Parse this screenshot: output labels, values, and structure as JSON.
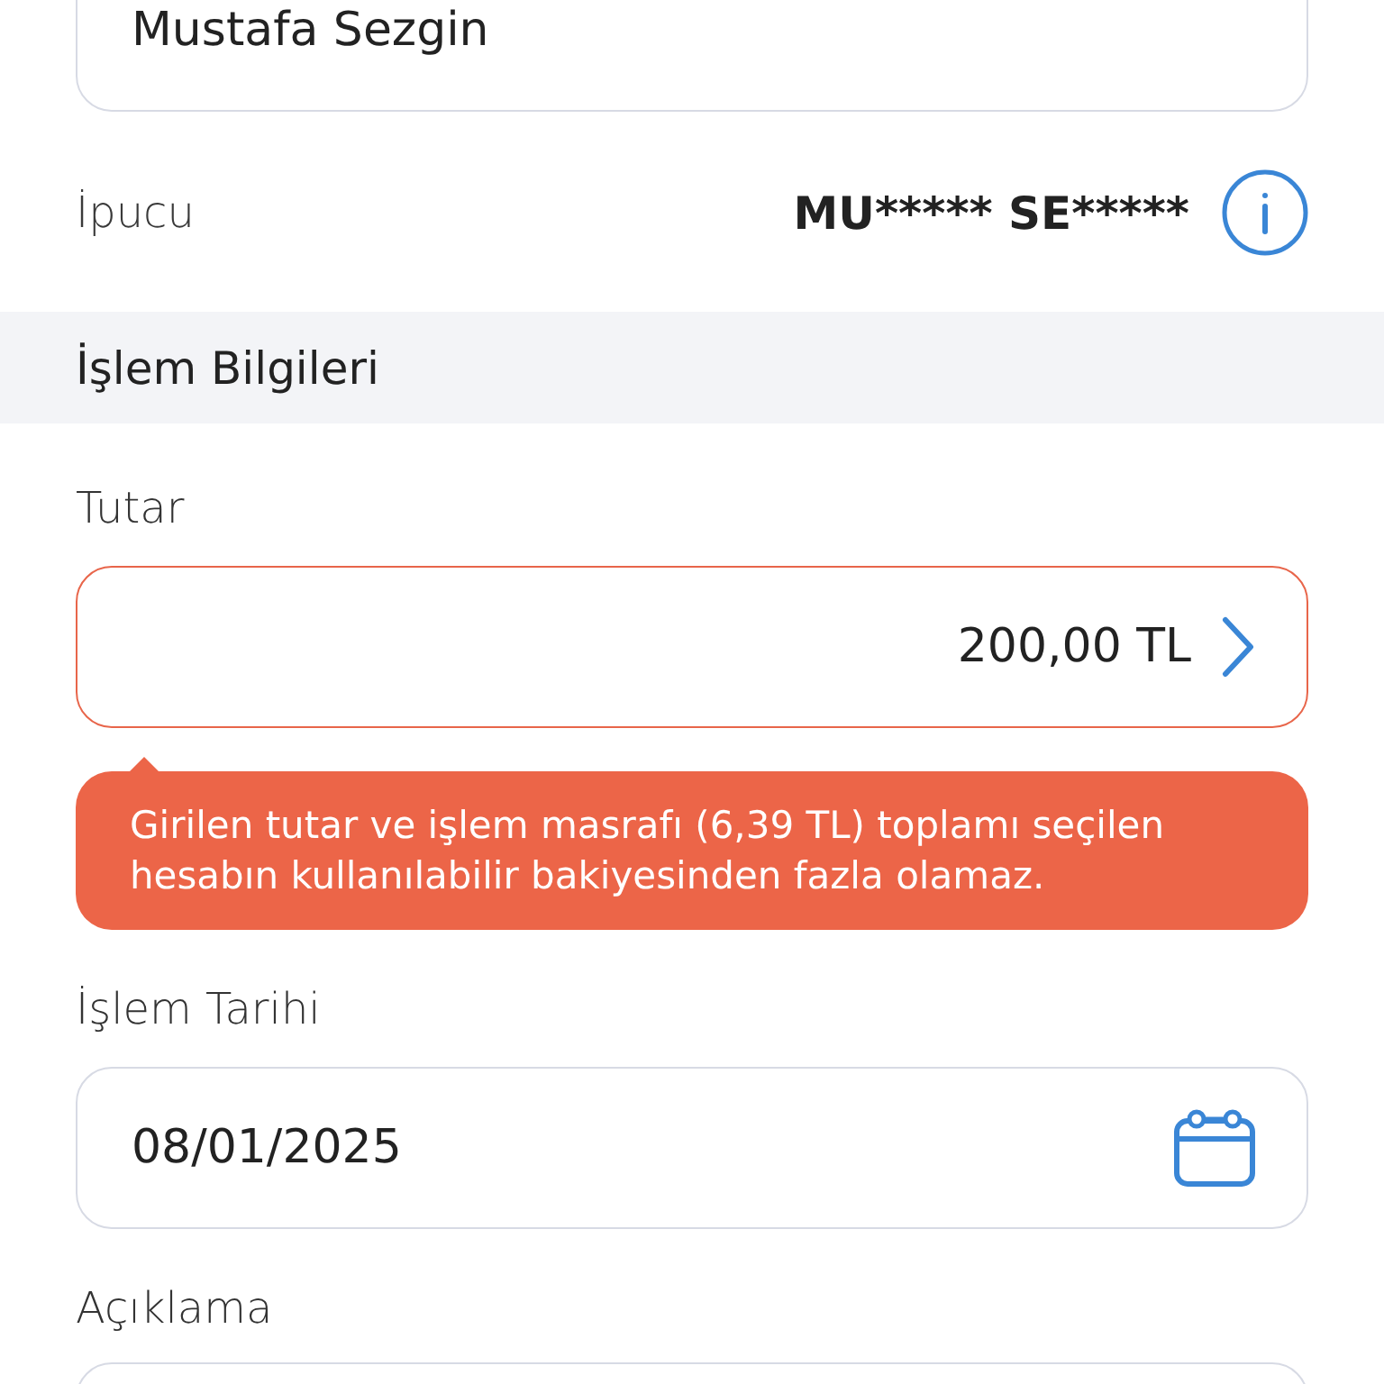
{
  "recipient": {
    "name_field": {
      "value": "Mustafa Sezgin"
    },
    "hint": {
      "label": "İpucu",
      "value": "MU***** SE*****"
    }
  },
  "section": {
    "title": "İşlem Bilgileri"
  },
  "fields": [
    {
      "kind": "amount",
      "label": "Tutar",
      "value": "200,00 TL",
      "invalid": true,
      "error_message": "Girilen tutar ve işlem masrafı (6,39 TL) toplamı seçilen hesabın kullanılabilir bakiyesinden fazla olamaz."
    },
    {
      "kind": "date",
      "label": "İşlem Tarihi",
      "value": "08/01/2025",
      "invalid": false
    },
    {
      "kind": "text",
      "label": "Açıklama",
      "invalid": false
    }
  ]
}
